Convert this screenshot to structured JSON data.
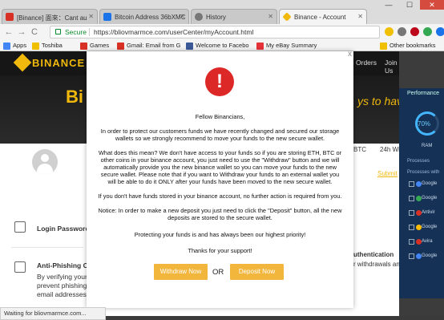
{
  "browser": {
    "tabs": [
      {
        "title": "[Binance] 面來：Cant au",
        "icon_color": "#d93025"
      },
      {
        "title": "Bitcoin Address 36bXMC",
        "icon_color": "#1a73e8"
      },
      {
        "title": "History",
        "icon_color": "#777777"
      },
      {
        "title": "Binance - Account",
        "icon_color": "#f0b90b"
      }
    ],
    "window_buttons": {
      "minimize": "—",
      "maximize": "☐",
      "close": "✕"
    },
    "nav": {
      "back": "←",
      "forward": "→",
      "reload": "C",
      "home": "⌂"
    },
    "omnibox": {
      "secure_label": "Secure",
      "url": "https://bliovmarmce.com/userCenter/myAccount.html"
    },
    "bookmarks": [
      {
        "label": "Apps",
        "icon_color": "#4285f4"
      },
      {
        "label": "Toshiba",
        "icon_color": "#f0c000"
      },
      {
        "label": "Games",
        "icon_color": "#d93025"
      },
      {
        "label": "Gmail: Email from G",
        "icon_color": "#d93025"
      },
      {
        "label": "Welcome to Facebo",
        "icon_color": "#3b5998"
      },
      {
        "label": "My eBay Summary",
        "icon_color": "#e53238"
      },
      {
        "label": "Other bookmarks",
        "icon_color": "#f0c000"
      }
    ],
    "status_text": "Waiting for bliovmarmce.com..."
  },
  "site": {
    "logo_text": "BINANCE",
    "nav_right": [
      "Orders",
      "Join Us",
      "Supp"
    ],
    "hero_left": "Bi",
    "hero_right": "ys to have",
    "login_password": "Login Password",
    "anti_phishing_title": "Anti-Phishing C",
    "anti_phishing_lines": [
      "By verifying your",
      "prevent phishing",
      "email addresses."
    ],
    "right_cols": [
      "BTC",
      "24h Wit"
    ],
    "submit_link": "Submit",
    "authentication": "uthentication",
    "withdrawals_text": "r withdrawals and"
  },
  "modal": {
    "close": "x",
    "greeting": "Fellow Binancians,",
    "p1": "In order to protect our customers funds we have recently changed and secured our storage wallets so we strongly recommend to move your funds to the new secure wallet.",
    "p2": "What does this mean? We don't have access to your funds so if you are storing ETH, BTC or other coins in your binance account, you just need to use the \"Withdraw\" button and we will automatically provide you the new binance wallet so you can move your funds to the new secure wallet. Please note that if you want to Withdraw your funds to an external wallet you will be able to do it ONLY after your funds have been moved to the new secure wallet.",
    "p3": "If you don't have funds stored in your binance account, no further action is required from you.",
    "p4": "Notice: In order to make a new deposit you just need to click the \"Deposit\" button, all the new deposits are stored to the secure wallet.",
    "p5": "Protecting your funds is and has always been our highest priority!",
    "p6": "Thanks for your support!",
    "withdraw_label": "Withdraw Now",
    "or_label": "OR",
    "deposit_label": "Deposit Now"
  },
  "overlay": {
    "title": "Performance",
    "percent": "70%",
    "ram_label": "RAM",
    "processes_header": "Processes",
    "processes_with_header": "Processes with",
    "processes": [
      {
        "name": "Google",
        "color": "#4285f4"
      },
      {
        "name": "Google",
        "color": "#34a853"
      },
      {
        "name": "Antivir",
        "color": "#d93025"
      },
      {
        "name": "Google",
        "color": "#fbbc05"
      },
      {
        "name": "Avira",
        "color": "#d93025"
      },
      {
        "name": "Google",
        "color": "#4285f4"
      }
    ]
  },
  "colors": {
    "binance_yellow": "#f0b90b",
    "alert_red": "#dd2828",
    "button_orange": "#f2b63c"
  }
}
